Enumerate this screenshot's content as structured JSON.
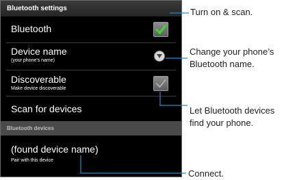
{
  "screen": {
    "title": "Bluetooth settings",
    "items": [
      {
        "label": "Bluetooth",
        "control": "checkbox-checked-icon"
      },
      {
        "label": "Device name",
        "sublabel": "(your phone's name)",
        "control": "dropdown-arrow-icon"
      },
      {
        "label": "Discoverable",
        "sublabel": "Make device discoverable",
        "control": "checkbox-unchecked-icon"
      },
      {
        "label": "Scan for devices"
      }
    ],
    "section_header": "Bluetooth devices",
    "device": {
      "label": "(found device name)",
      "sublabel": "Pair with this device"
    }
  },
  "callouts": {
    "turn_on": "Turn on & scan.",
    "change_name_line1": "Change your phone’s",
    "change_name_line2": "Bluetooth name.",
    "discover_line1": "Let Bluetooth devices",
    "discover_line2": "find your phone.",
    "connect": "Connect."
  },
  "colors": {
    "accent_check": "#3fd62b",
    "callout_line": "#1b8fd0",
    "screen_bg": "#000000",
    "section_bg": "#4a4a4a"
  }
}
